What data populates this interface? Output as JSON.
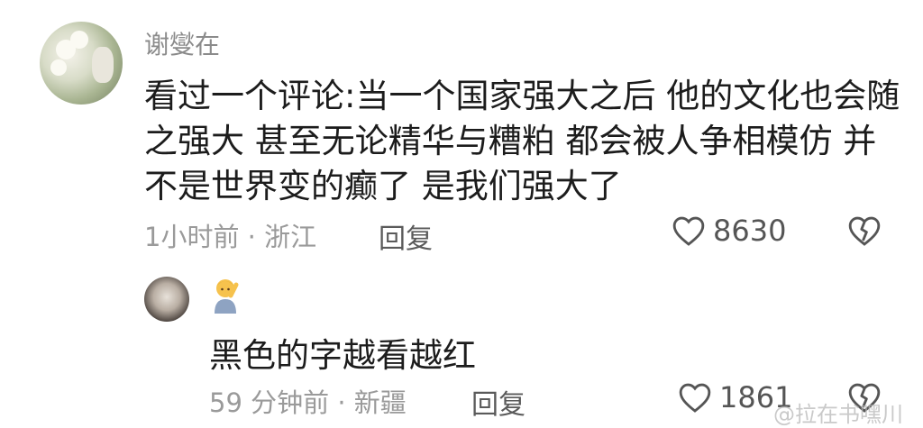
{
  "comment": {
    "username": "谢燮在",
    "text": "看过一个评论:当一个国家强大之后 他的文化也会随之强大 甚至无论精华与糟粕 都会被人争相模仿 并不是世界变的癫了 是我们强大了",
    "meta": "1小时前 · 浙江",
    "reply_label": "回复",
    "like_count": "8630"
  },
  "reply": {
    "badge_icon": "person-emoji-icon",
    "text": "黑色的字越看越红",
    "meta": "59 分钟前 · 新疆",
    "reply_label": "回复",
    "like_count": "1861"
  },
  "watermark": {
    "text": "@拉在书嘿川"
  },
  "colors": {
    "text": "#1c1c1c",
    "meta": "#9a9a9a",
    "username": "#8b8b8b"
  }
}
